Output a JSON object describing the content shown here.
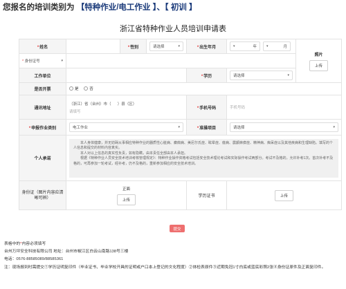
{
  "headline": {
    "prefix": "您报名的培训类别为",
    "category": "【特种作业/电工作业",
    "separator": "】、【",
    "level": "初训",
    "suffix": "】"
  },
  "form_title": "浙江省特种作业人员培训申请表",
  "fields": {
    "name_label": "姓名",
    "gender_label": "性别",
    "gender_value": "请选择",
    "birth_label": "出生年月",
    "birth_year": "年",
    "birth_month": "月",
    "photo_label": "照片",
    "upload": "上传",
    "idtype_label": "身份证号",
    "work_label": "工作单位",
    "edu_label": "学历",
    "edu_value": "请选择",
    "retire_label": "是否开票",
    "yes": "是",
    "no": "否",
    "address_label": "通讯地址",
    "addr_province": "（浙江）省（台州）市（",
    "addr_county": "）县（区）",
    "addr_ph": "请填写",
    "phone_label": "手机号码",
    "phone_ph": "手机号码",
    "job_type_label": "申报作业类别",
    "job_type_value": "电工作业",
    "project_label": "准操项目",
    "project_value": "请选择",
    "promise_label": "个人承诺",
    "promise_text": [
      "本人身体健康，并无妨碍从事相应特种作业的器质性心脏病、癫痫病、美尼尔氏症、眩晕症、癔病、震颤麻痹症、精神病、痴呆症以及其他疾病和生理缺陷。填写的个人信息和提交的材料内容真实。",
      "本人对以上信息的真实性负责，如有隐瞒，由本责任全部由本人承担。",
      "根据《特种作业人员安全技术培训考核管理规定》：特种作业操作资格考试包括安全技术理论考试和实际操作考试两部分。考试不及格的，允许补考1次。首次补考不及格的，可再参加一轮考试，经补考，仍不及格的，重新参加相应的安全技术培训。"
    ],
    "idcard_label": "身份证（图片内容应清晰可辨）",
    "idcard_front": "正面",
    "diploma_label": "学历证书"
  },
  "submit": "提交",
  "notes": {
    "required_note_pre": "表格中的",
    "required_star": "*",
    "required_note_post": "内容必须填写",
    "company": "台州万坪安全科技有限公司 地址：台州市椒江区白云山南路138号三楼",
    "phone": "电话：0576-88585089/88585361",
    "remark": "注：现场报到时需提交①学历证明复印件（毕业证书、毕业学校开具的证明或户口本上登记的文化程度）②体检表原件③近期免冠1寸白底或蓝底彩照2张④身份证原件及正面复印件。"
  }
}
